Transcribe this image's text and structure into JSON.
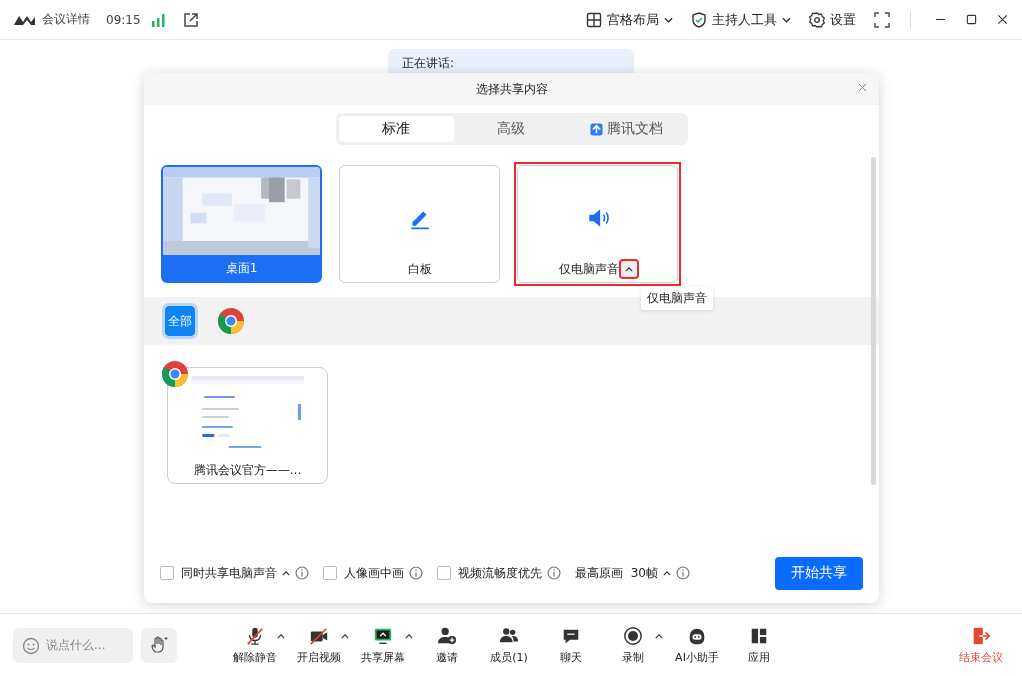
{
  "top_bar": {
    "title": "会议详情",
    "time": "09:15",
    "menus": [
      {
        "label": "宫格布局",
        "kind": "grid",
        "dropdown": true
      },
      {
        "label": "主持人工具",
        "kind": "shield",
        "dropdown": true
      },
      {
        "label": "设置",
        "kind": "gear",
        "dropdown": false
      }
    ]
  },
  "speaking": {
    "label": "正在讲话:"
  },
  "dialog": {
    "title": "选择共享内容",
    "tabs": [
      {
        "label": "标准",
        "selected": true,
        "kind": "text"
      },
      {
        "label": "高级",
        "selected": false,
        "kind": "text"
      },
      {
        "label": "腾讯文档",
        "selected": false,
        "kind": "docs"
      }
    ],
    "sources": [
      {
        "label": "桌面1",
        "kind": "desktop",
        "selected": true,
        "highlighted": false
      },
      {
        "label": "白板",
        "kind": "whiteboard",
        "selected": false,
        "highlighted": false
      },
      {
        "label": "仅电脑声音",
        "kind": "audio",
        "selected": false,
        "highlighted": true
      }
    ],
    "tooltip": "仅电脑声音",
    "filters": [
      {
        "kind": "all",
        "label": "全部",
        "selected": true
      },
      {
        "kind": "chrome",
        "selected": false
      }
    ],
    "windows": [
      {
        "label": "腾讯会议官方——..."
      }
    ],
    "options": [
      {
        "kind": "checkbox",
        "label": "同时共享电脑声音",
        "checked": false,
        "caret": true
      },
      {
        "kind": "checkbox",
        "label": "人像画中画",
        "checked": false,
        "caret": false
      },
      {
        "kind": "checkbox",
        "label": "视频流畅度优先",
        "checked": false,
        "caret": false
      },
      {
        "kind": "text",
        "label": "最高原画  30帧",
        "caret": true
      }
    ],
    "start_button": "开始共享"
  },
  "toolbar": {
    "chat_placeholder": "说点什么...",
    "items": [
      {
        "label": "解除静音",
        "kind": "mic-off",
        "caret": true
      },
      {
        "label": "开启视频",
        "kind": "camera-off",
        "caret": true
      },
      {
        "label": "共享屏幕",
        "kind": "share",
        "caret": true
      },
      {
        "label": "邀请",
        "kind": "invite",
        "caret": false
      },
      {
        "label": "成员(1)",
        "kind": "members",
        "caret": false
      },
      {
        "label": "聊天",
        "kind": "chat",
        "caret": false
      },
      {
        "label": "录制",
        "kind": "record",
        "caret": true
      },
      {
        "label": "AI小助手",
        "kind": "ai",
        "caret": false
      },
      {
        "label": "应用",
        "kind": "apps",
        "caret": false
      }
    ],
    "end_button": "结束会议"
  }
}
